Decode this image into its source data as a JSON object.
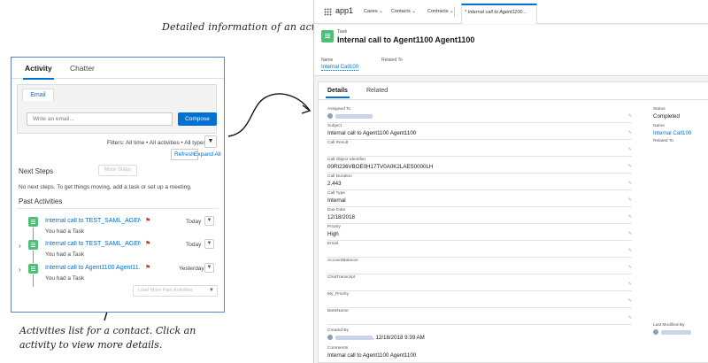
{
  "annotations": {
    "top": "Detailed information of an activity",
    "bottom": "Activities list for a contact. Click an activity to view more details."
  },
  "left": {
    "tabs": [
      "Activity",
      "Chatter"
    ],
    "composer": {
      "tab_label": "Email",
      "input_placeholder": "Write an email...",
      "compose_label": "Compose"
    },
    "filters_text": "Filters: All time • All activities • All types",
    "refresh_label": "Refresh",
    "expand_label": "Expand All",
    "next_steps_title": "Next Steps",
    "more_steps_label": "More Steps",
    "no_steps_text": "No next steps. To get things moving, add a task or set up a meeting.",
    "past_title": "Past Activities",
    "activities": [
      {
        "title": "Internal call to TEST_SAML_AGENT_...",
        "date": "Today",
        "subtitle": "You had a Task"
      },
      {
        "title": "Internal call to TEST_SAML_AGENT_...",
        "date": "Today",
        "subtitle": "You had a Task"
      },
      {
        "title": "Internal call to Agent1100 Agent11...",
        "date": "Yesterday",
        "subtitle": "You had a Task"
      }
    ],
    "load_more_label": "Load More Past Activities"
  },
  "right": {
    "app_name": "app1",
    "nav_items": [
      "Cases",
      "Contacts",
      "Contracts"
    ],
    "active_tab": "* Internal call to Agent1100...",
    "record_type": "Task",
    "record_title": "Internal call to Agent1100 Agent1100",
    "highlights": {
      "name_label": "Name",
      "name_value": "Internal Call100",
      "related_label": "Related To"
    },
    "tabs": [
      "Details",
      "Related"
    ],
    "fields": [
      {
        "label": "Assigned To",
        "value": ""
      },
      {
        "label": "Subject",
        "value": "Internal call to Agent1100 Agent1100"
      },
      {
        "label": "Call Result",
        "value": ""
      },
      {
        "label": "Call Object Identifier",
        "value": "00RI236VBOE0H17TV0A0K2LAES0000LH"
      },
      {
        "label": "Call Duration",
        "value": "2,443"
      },
      {
        "label": "Call Type",
        "value": "Internal"
      },
      {
        "label": "Due Date",
        "value": "12/18/2018"
      },
      {
        "label": "Priority",
        "value": "High"
      },
      {
        "label": "Email",
        "value": ""
      },
      {
        "label": "AccountBalance",
        "value": ""
      },
      {
        "label": "ChatTranscript",
        "value": ""
      },
      {
        "label": "My_Priority",
        "value": ""
      },
      {
        "label": "BankName",
        "value": ""
      },
      {
        "label": "Created By",
        "value": "12/18/2018 9:39 AM"
      },
      {
        "label": "Comments",
        "value": "Internal call to Agent1100 Agent1100"
      }
    ],
    "side_fields": [
      {
        "label": "Status",
        "value": "Completed"
      },
      {
        "label": "Name",
        "value": "Internal Call100"
      },
      {
        "label": "Related To",
        "value": ""
      }
    ],
    "last_modified_label": "Last Modified By"
  }
}
